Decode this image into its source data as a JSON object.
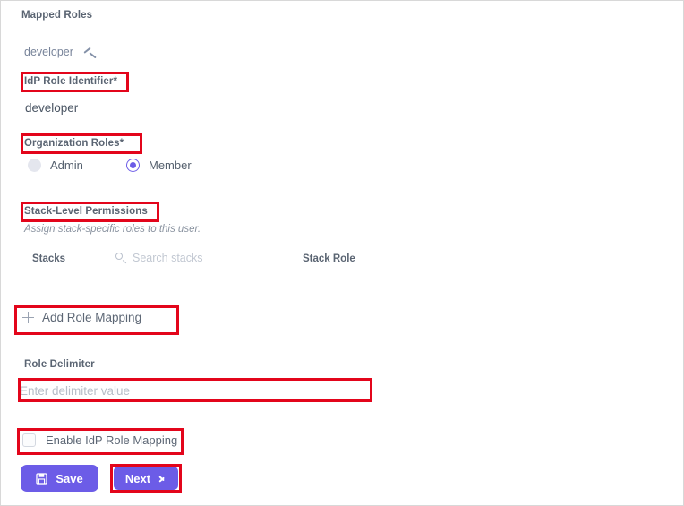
{
  "panel": {
    "section_title": "Mapped Roles"
  },
  "role_group": {
    "name": "developer",
    "collapse_icon": "chevron-up-icon",
    "expanded": true
  },
  "fields": {
    "idp_role_identifier": {
      "label": "IdP Role Identifier*",
      "value": "developer"
    },
    "organization_roles": {
      "label": "Organization Roles*",
      "options": [
        {
          "label": "Admin",
          "selected": false
        },
        {
          "label": "Member",
          "selected": true
        }
      ]
    },
    "stack_level_permissions": {
      "label": "Stack-Level Permissions",
      "hint": "Assign stack-specific roles to this user."
    },
    "role_delimiter": {
      "label": "Role Delimiter",
      "value": "",
      "placeholder": "Enter delimiter value"
    },
    "enable_idp_role_mapping": {
      "label": "Enable IdP Role Mapping",
      "checked": false
    }
  },
  "stacks_table": {
    "column_stacks": "Stacks",
    "column_stack_role": "Stack Role",
    "search": {
      "icon": "search-icon",
      "placeholder": "Search stacks",
      "value": ""
    },
    "rows": []
  },
  "actions": {
    "add_role_mapping": {
      "label": "Add Role Mapping",
      "icon": "plus-icon"
    },
    "save": {
      "label": "Save",
      "icon": "floppy-disk-icon"
    },
    "next": {
      "label": "Next",
      "icon": "chevron-right-icon"
    }
  },
  "colors": {
    "primary": "#6c5ce7",
    "annotation": "#e3051b",
    "label_text": "#5a6472",
    "placeholder": "#b7bdc7"
  },
  "annotations": [
    {
      "target": "idp-role-identifier-label"
    },
    {
      "target": "organization-roles-label"
    },
    {
      "target": "stack-level-permissions-label"
    },
    {
      "target": "add-role-mapping-button"
    },
    {
      "target": "role-delimiter-input"
    },
    {
      "target": "enable-idp-role-mapping-checkbox"
    },
    {
      "target": "next-button"
    }
  ]
}
